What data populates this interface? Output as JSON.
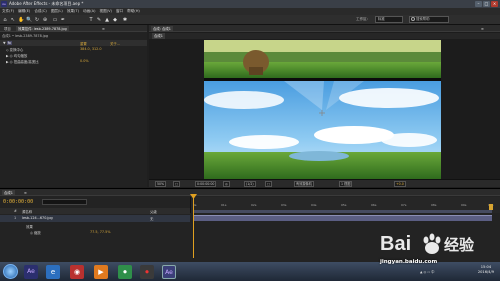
{
  "title_bar": {
    "title": "Adobe After Effects - 未命名项目.aep *",
    "app_abbr": "Ae",
    "buttons": [
      "–",
      "□",
      "×"
    ]
  },
  "menu": [
    "文件(F)",
    "编辑(E)",
    "合成(C)",
    "图层(L)",
    "效果(T)",
    "动画(A)",
    "视图(V)",
    "窗口",
    "帮助(H)"
  ],
  "toolbar": {
    "tools": [
      "⌂",
      "↖",
      "✋",
      "🔍",
      "↻",
      "⊕",
      "▭",
      "✒",
      "T",
      "✎",
      "▲",
      "◆",
      "✱"
    ],
    "workspace_label": "工作区:",
    "workspace_value": "标准",
    "search_placeholder": "搜索帮助"
  },
  "project_panel": {
    "tabs": [
      "项目",
      "效果控件: lesb-2389-7878.jpg",
      "≡"
    ],
    "fx_path": "合成1 • lesb-2389-7878.jpg",
    "fx_label": "fx",
    "reset": "重置",
    "about": "关于...",
    "props": [
      {
        "name": "◇ 变换中心",
        "value": "384.0, 312.0"
      },
      {
        "name": "▶ ◎ 均匀缩放",
        "value": ""
      },
      {
        "name": "▶ ◎ 扭曲高度/高宽比",
        "value": "0.0%"
      }
    ]
  },
  "comp_panel": {
    "tabs": [
      "合成: 合成1",
      "≡"
    ],
    "subtab": "合成1",
    "footer": [
      "50%",
      "□",
      "0:00:00:00",
      "◎",
      "(1/2)",
      "□",
      "有效摄像机",
      "1 视图",
      "+0.0"
    ]
  },
  "timeline": {
    "tabs": [
      "合成1",
      "≡"
    ],
    "current_time": "0:00:00:00",
    "columns": [
      "#",
      "源名称",
      "父级"
    ],
    "layer": {
      "index": "1",
      "name": "lesb-124...670.jpg",
      "parent": "无"
    },
    "sub_rows": [
      {
        "name": "效果",
        "value": ""
      },
      {
        "name": "◎ 缩放",
        "value": "77.5, 77.5%"
      }
    ],
    "ticks": [
      "0s",
      "01s",
      "02s",
      "03s",
      "04s",
      "05s",
      "06s",
      "07s",
      "08s",
      "09s",
      "10s"
    ]
  },
  "taskbar": {
    "apps": [
      "Ae",
      "e",
      "◉",
      "▶",
      "⏺",
      "Ae"
    ],
    "clock_time": "15:04",
    "clock_date": "2016/4/9",
    "tray": "▲ ◎ ▭ 中"
  },
  "watermark": {
    "brand": "Bai",
    "brand_cn": "经验",
    "url": "jingyan.baidu.com"
  },
  "colors": {
    "timecode": "#e6b43a",
    "layer_bar": "#5b5e83",
    "playhead": "#e0a020"
  }
}
